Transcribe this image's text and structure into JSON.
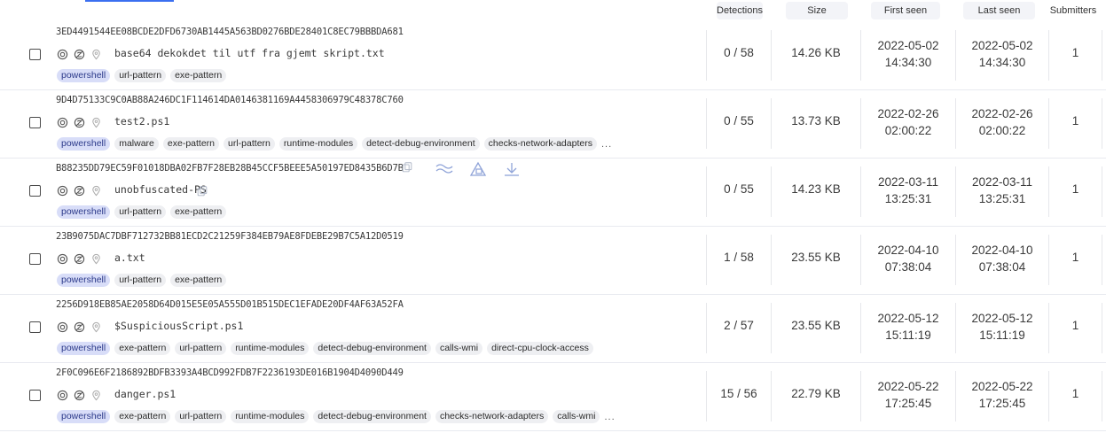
{
  "columns": {
    "detections": "Detections",
    "size": "Size",
    "first_seen": "First seen",
    "last_seen": "Last seen",
    "submitters": "Submitters"
  },
  "rows": [
    {
      "hash": "3ED4491544EE08BCDE2DFD6730AB1445A563BD0276BDE28401C8EC79BBBDA681",
      "filename": "base64 dekokdet til utf fra gjemt skript.txt",
      "tags": [
        "powershell",
        "url-pattern",
        "exe-pattern"
      ],
      "more": "",
      "detections": "0 / 58",
      "size": "14.26 KB",
      "first_seen_date": "2022-05-02",
      "first_seen_time": "14:34:30",
      "last_seen_date": "2022-05-02",
      "last_seen_time": "14:34:30",
      "submitters": "1"
    },
    {
      "hash": "9D4D75133C9C0AB88A246DC1F114614DA0146381169A4458306979C48378C760",
      "filename": "test2.ps1",
      "tags": [
        "powershell",
        "malware",
        "exe-pattern",
        "url-pattern",
        "runtime-modules",
        "detect-debug-environment",
        "checks-network-adapters"
      ],
      "more": "...",
      "detections": "0 / 55",
      "size": "13.73 KB",
      "first_seen_date": "2022-02-26",
      "first_seen_time": "02:00:22",
      "last_seen_date": "2022-02-26",
      "last_seen_time": "02:00:22",
      "submitters": "1"
    },
    {
      "hash": "B88235DD79EC59F01018DBA02FB7F28EB28B45CCF5BEEE5A50197ED8435B6D7B",
      "filename": "unobfuscated-PS",
      "tags": [
        "powershell",
        "url-pattern",
        "exe-pattern"
      ],
      "more": "",
      "detections": "0 / 55",
      "size": "14.23 KB",
      "first_seen_date": "2022-03-11",
      "first_seen_time": "13:25:31",
      "last_seen_date": "2022-03-11",
      "last_seen_time": "13:25:31",
      "submitters": "1"
    },
    {
      "hash": "23B9075DAC7DBF712732BB81ECD2C21259F384EB79AE8FDEBE29B7C5A12D0519",
      "filename": "a.txt",
      "tags": [
        "powershell",
        "url-pattern",
        "exe-pattern"
      ],
      "more": "",
      "detections": "1 / 58",
      "size": "23.55 KB",
      "first_seen_date": "2022-04-10",
      "first_seen_time": "07:38:04",
      "last_seen_date": "2022-04-10",
      "last_seen_time": "07:38:04",
      "submitters": "1"
    },
    {
      "hash": "2256D918EB85AE2058D64D015E5E05A555D01B515DEC1EFADE20DF4AF63A52FA",
      "filename": "$SuspiciousScript.ps1",
      "tags": [
        "powershell",
        "exe-pattern",
        "url-pattern",
        "runtime-modules",
        "detect-debug-environment",
        "calls-wmi",
        "direct-cpu-clock-access"
      ],
      "more": "",
      "detections": "2 / 57",
      "size": "23.55 KB",
      "first_seen_date": "2022-05-12",
      "first_seen_time": "15:11:19",
      "last_seen_date": "2022-05-12",
      "last_seen_time": "15:11:19",
      "submitters": "1"
    },
    {
      "hash": "2F0C096E6F2186892BDFB3393A4BCD992FDB7F2236193DE016B1904D4090D449",
      "filename": "danger.ps1",
      "tags": [
        "powershell",
        "exe-pattern",
        "url-pattern",
        "runtime-modules",
        "detect-debug-environment",
        "checks-network-adapters",
        "calls-wmi"
      ],
      "more": "...",
      "detections": "15 / 56",
      "size": "22.79 KB",
      "first_seen_date": "2022-05-22",
      "first_seen_time": "17:25:45",
      "last_seen_date": "2022-05-22",
      "last_seen_time": "17:25:45",
      "submitters": "1"
    }
  ],
  "row_icons": [
    "file-type-icon",
    "no-sandbox-icon",
    "location-pin-icon"
  ],
  "hover_actions": [
    "copy-icon",
    "similar-icon",
    "graph-icon",
    "download-icon"
  ],
  "colors": {
    "accent": "#3b6ff0",
    "primary_tag_bg": "#d8ddf8",
    "tag_bg": "#eeeff2"
  }
}
